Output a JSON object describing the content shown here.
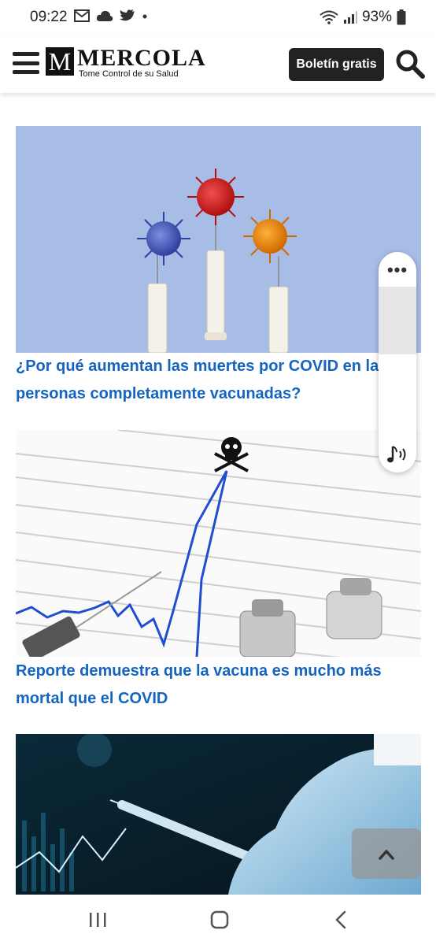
{
  "status_bar": {
    "time": "09:22",
    "left_icons": [
      "mail-icon",
      "cloud-icon",
      "twitter-icon",
      "dot-icon"
    ],
    "right_icons": [
      "wifi-icon",
      "signal-icon",
      "battery-icon"
    ],
    "battery": "93%"
  },
  "header": {
    "logo_mark": "M",
    "logo_name": "MERCOLA",
    "logo_tagline": "Tome Control de su Salud",
    "newsletter_label": "Boletín gratis"
  },
  "articles": [
    {
      "title": "¿Por qué aumentan las muertes por COVID en las personas completamente vacunadas?",
      "image": "vaccine-syringes-virus-image"
    },
    {
      "title": "Reporte demuestra que la vacuna es mucho más mortal que el COVID",
      "image": "mortality-chart-skull-image"
    },
    {
      "title": "",
      "image": "gloved-hand-syringe-image"
    }
  ],
  "audio_widget": {
    "menu_icon": "more-dots-icon",
    "play_icon": "music-note-icon"
  },
  "colors": {
    "link": "#1565c0",
    "button_bg": "#222222",
    "image1_bg": "#a7bde6",
    "image3_bg": "#0b2330"
  }
}
